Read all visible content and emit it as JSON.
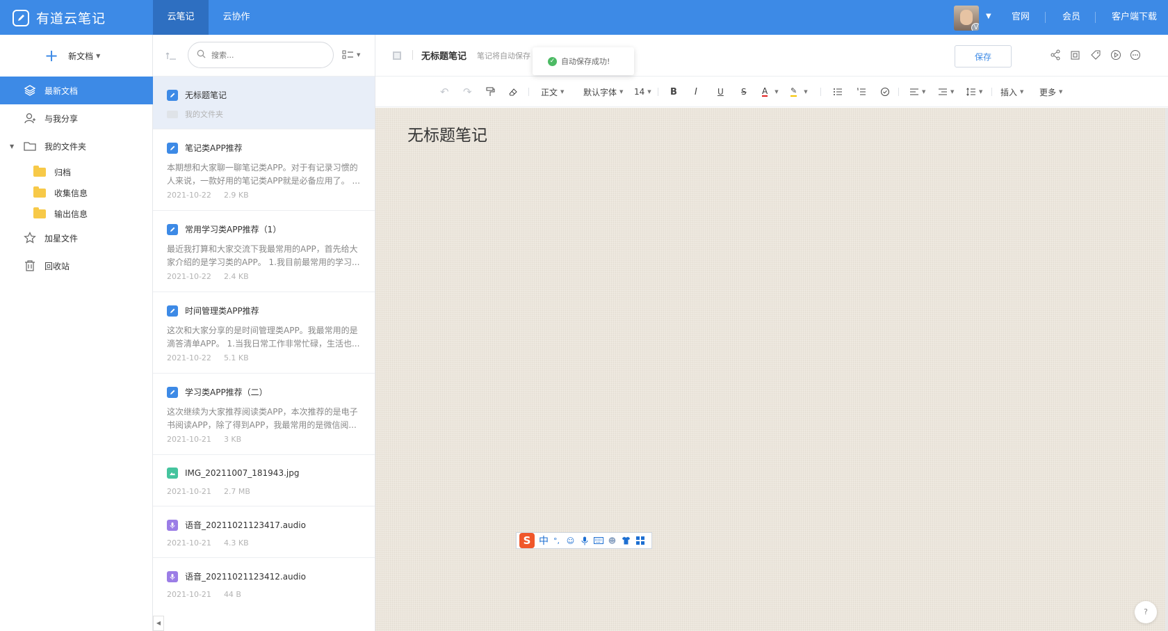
{
  "topbar": {
    "app_name": "有道云笔记",
    "tabs": [
      {
        "label": "云笔记",
        "active": true
      },
      {
        "label": "云协作",
        "active": false
      }
    ],
    "avatar_badge": "V",
    "links": [
      "官网",
      "会员",
      "客户端下载"
    ],
    "color": "#3d8ae6"
  },
  "sidebar": {
    "new_doc_label": "新文档",
    "items": [
      {
        "label": "最新文档",
        "icon": "layers-icon",
        "active": true
      },
      {
        "label": "与我分享",
        "icon": "share-users-icon",
        "active": false
      },
      {
        "label": "我的文件夹",
        "icon": "folder-outline-icon",
        "active": false
      }
    ],
    "folders": [
      "归档",
      "收集信息",
      "输出信息"
    ],
    "bottom_items": [
      {
        "label": "加星文件",
        "icon": "star-icon"
      },
      {
        "label": "回收站",
        "icon": "trash-icon"
      }
    ]
  },
  "list": {
    "search_placeholder": "搜索...",
    "notes": [
      {
        "title": "无标题笔记",
        "type": "note",
        "folder": "我的文件夹",
        "active": true
      },
      {
        "title": "笔记类APP推荐",
        "type": "note",
        "body": "本期想和大家聊一聊笔记类APP。对于有记录习惯的人来说，一款好用的笔记类APP就是必备应用了。 ...",
        "date": "2021-10-22",
        "size": "2.9 KB"
      },
      {
        "title": "常用学习类APP推荐（1）",
        "type": "note",
        "body": "最近我打算和大家交流下我最常用的APP，首先给大家介绍的是学习类的APP。 1.我目前最常用的学习...",
        "date": "2021-10-22",
        "size": "2.4 KB"
      },
      {
        "title": "时间管理类APP推荐",
        "type": "note",
        "body": "这次和大家分享的是时间管理类APP。我最常用的是滴答清单APP。 1.当我日常工作非常忙碌，生活也...",
        "date": "2021-10-22",
        "size": "5.1 KB"
      },
      {
        "title": "学习类APP推荐（二）",
        "type": "note",
        "body": "这次继续为大家推荐阅读类APP，本次推荐的是电子书阅读APP，除了得到APP，我最常用的是微信阅...",
        "date": "2021-10-21",
        "size": "3 KB"
      },
      {
        "title": "IMG_20211007_181943.jpg",
        "type": "image",
        "date": "2021-10-21",
        "size": "2.7 MB"
      },
      {
        "title": "语音_20211021123417.audio",
        "type": "audio",
        "date": "2021-10-21",
        "size": "4.3 KB"
      },
      {
        "title": "语音_20211021123412.audio",
        "type": "audio",
        "date": "2021-10-21",
        "size": "44 B"
      }
    ]
  },
  "editor": {
    "title": "无标题笔记",
    "autosave_text": "笔记将自动保存",
    "toast": "自动保存成功!",
    "save_label": "保存",
    "toolbar": {
      "style": "正文",
      "font": "默认字体",
      "size": "14",
      "insert": "插入",
      "more": "更多"
    },
    "content_title": "无标题笔记",
    "help": "?"
  },
  "ime": {
    "logo": "S",
    "lang": "中",
    "punct": "°,"
  }
}
